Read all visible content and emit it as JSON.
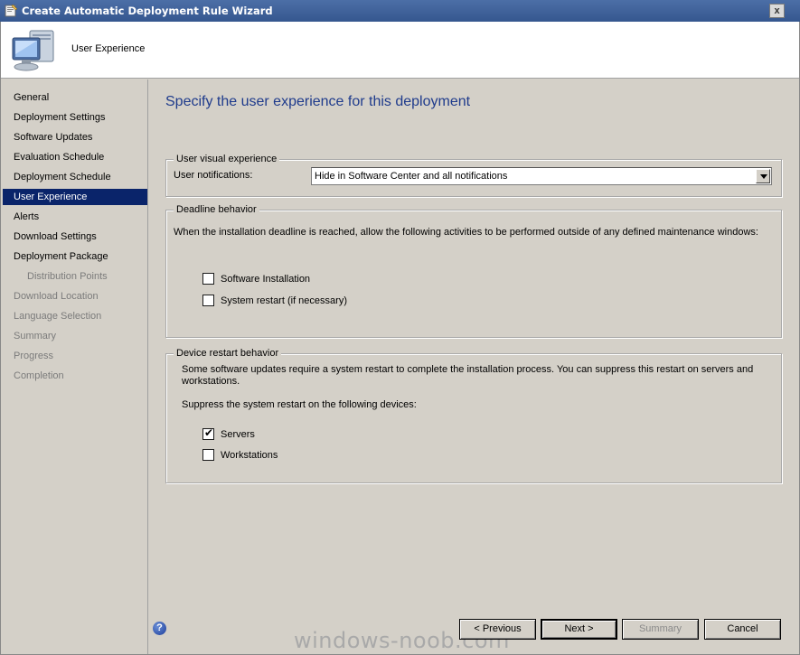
{
  "window": {
    "title": "Create Automatic Deployment Rule Wizard",
    "close_glyph": "x"
  },
  "header": {
    "title": "User Experience",
    "icon": "computer-icon"
  },
  "sidebar": {
    "items": [
      {
        "label": "General",
        "state": "normal"
      },
      {
        "label": "Deployment Settings",
        "state": "normal"
      },
      {
        "label": "Software Updates",
        "state": "normal"
      },
      {
        "label": "Evaluation Schedule",
        "state": "normal"
      },
      {
        "label": "Deployment Schedule",
        "state": "normal"
      },
      {
        "label": "User Experience",
        "state": "active"
      },
      {
        "label": "Alerts",
        "state": "normal"
      },
      {
        "label": "Download Settings",
        "state": "normal"
      },
      {
        "label": "Deployment Package",
        "state": "normal"
      },
      {
        "label": "Distribution Points",
        "state": "disabled"
      },
      {
        "label": "Download Location",
        "state": "disabled"
      },
      {
        "label": "Language Selection",
        "state": "disabled"
      },
      {
        "label": "Summary",
        "state": "disabled"
      },
      {
        "label": "Progress",
        "state": "disabled"
      },
      {
        "label": "Completion",
        "state": "disabled"
      }
    ]
  },
  "main": {
    "heading": "Specify the user experience for this deployment",
    "visual_experience": {
      "legend": "User visual experience",
      "notifications_label": "User notifications:",
      "notifications_value": "Hide in Software Center and all notifications"
    },
    "deadline": {
      "legend": "Deadline behavior",
      "description": "When the installation deadline is reached, allow the following activities to be performed outside of any defined maintenance windows:",
      "options": [
        {
          "label": "Software Installation",
          "checked": false
        },
        {
          "label": "System restart (if necessary)",
          "checked": false
        }
      ]
    },
    "restart": {
      "legend": "Device restart behavior",
      "description_line1": "Some software updates require a system restart to complete the installation process.  You can suppress this restart on servers and",
      "description_line2": "workstations.",
      "suppress_label": "Suppress the system restart on the following devices:",
      "options": [
        {
          "label": "Servers",
          "checked": true,
          "mark": "✔"
        },
        {
          "label": "Workstations",
          "checked": false,
          "mark": ""
        }
      ]
    }
  },
  "footer": {
    "help_glyph": "?",
    "previous_label": "< Previous",
    "next_label": "Next >",
    "summary_label": "Summary",
    "cancel_label": "Cancel",
    "watermark": "windows-noob.com"
  },
  "colors": {
    "title_bar": "#35578f",
    "heading": "#1f3b8c",
    "active_nav": "#0a246a",
    "dialog_bg": "#d4d0c8"
  }
}
